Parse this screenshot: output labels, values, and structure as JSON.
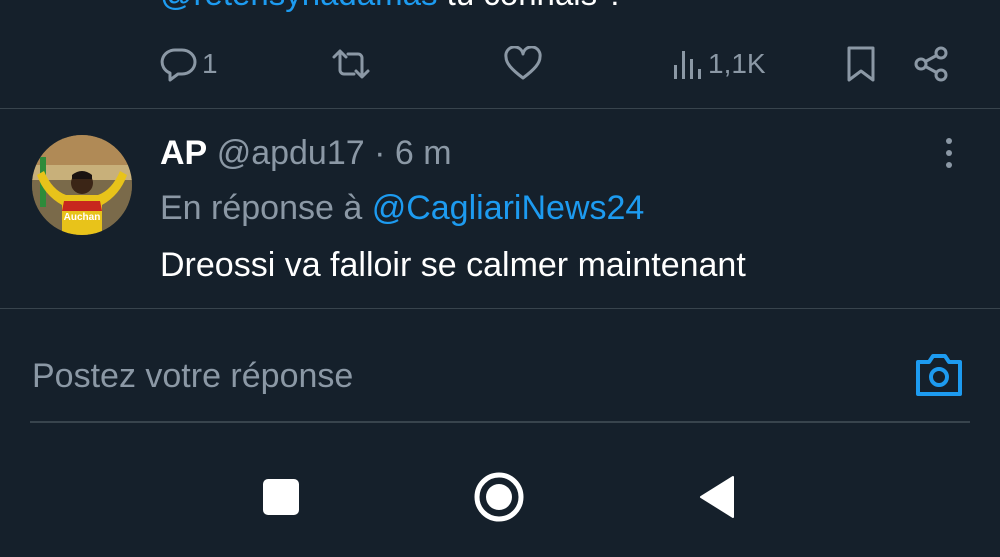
{
  "previous_tweet": {
    "mention": "@retensynadamas",
    "text": " tu connais ?",
    "actions": {
      "reply_count": "1",
      "views_count": "1,1K"
    }
  },
  "tweet": {
    "display_name": "AP",
    "handle_time": "@apdu17 · 6 m",
    "reply_prefix": "En réponse à ",
    "reply_mention": "@CagliariNews24",
    "body": "Dreossi va falloir se calmer maintenant"
  },
  "composer": {
    "placeholder": "Postez votre réponse"
  },
  "colors": {
    "background": "#15202b",
    "accent": "#1d9bf0",
    "secondary_text": "#8b98a5",
    "divider": "#38444d"
  },
  "icons": {
    "reply": "speech-bubble-icon",
    "retweet": "retweet-icon",
    "like": "heart-icon",
    "views": "bar-chart-icon",
    "bookmark": "bookmark-icon",
    "share": "share-icon",
    "more": "vertical-ellipsis-icon",
    "camera": "camera-icon",
    "nav_recents": "square-icon",
    "nav_home": "circle-icon",
    "nav_back": "triangle-back-icon"
  }
}
